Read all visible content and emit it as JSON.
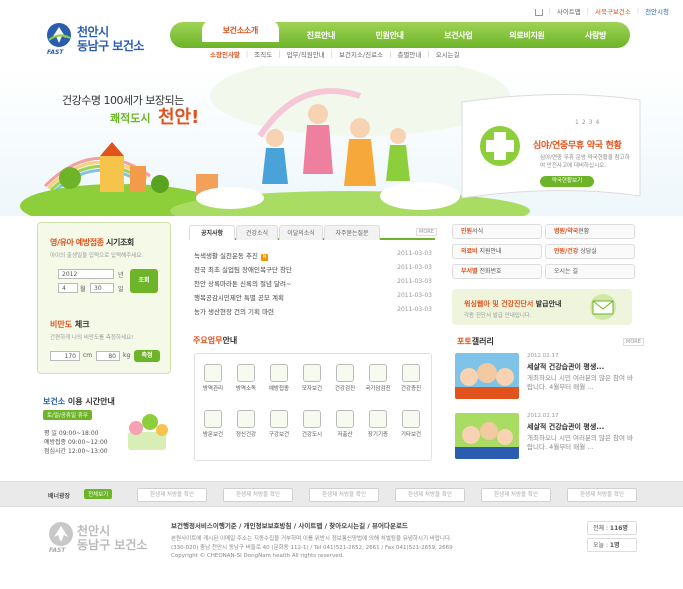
{
  "util": {
    "sitemap": "사이트맵",
    "english": "서북구보건소",
    "cityhall": "천안시청"
  },
  "logo": {
    "line1": "천안시",
    "line2": "동남구 보건소",
    "mark": "FAST"
  },
  "gnav": [
    "보건소소개",
    "진료안내",
    "민원안내",
    "보건사업",
    "의료비지원",
    "사랑방"
  ],
  "snav": [
    "소장인사말",
    "조직도",
    "업무/직원안내",
    "보건지소/진료소",
    "층별안내",
    "오시는길"
  ],
  "hero": {
    "slogan1": "건강수명 100세가 보장되는",
    "slogan2": "쾌적도시",
    "slogan3": "천안!",
    "card_title": "심야/연중무휴 약국 현황",
    "card_desc": "심야/연중 무휴 운영 약국현황을 참고하여 안전사고에 대비하십시오.",
    "card_button": "약국현황보기",
    "dots": [
      "1",
      "2",
      "3",
      "4"
    ]
  },
  "vaccination": {
    "title_accent": "영/유아 예방접종",
    "title": "시기조회",
    "desc": "아이의 출생일을 입력으로 입력해주세요.",
    "year": "2012",
    "year_unit": "년",
    "month": "4",
    "month_unit": "월",
    "day": "30",
    "day_unit": "일",
    "submit": "조회",
    "obesity_accent": "비만도",
    "obesity_title": "체크",
    "obesity_desc": "간편하게 나의 비만도를 측정하세요!",
    "height": "170",
    "height_unit": "cm",
    "weight": "80",
    "weight_unit": "kg",
    "measure": "측정"
  },
  "hours": {
    "title_accent": "보건소",
    "title": "이용 시간안내",
    "holiday": "토/일/공휴일 휴무",
    "rows": [
      {
        "label": "평 일",
        "value": "09:00~18:00"
      },
      {
        "label": "예방접종",
        "value": "09:00~12:00"
      },
      {
        "label": "점심시간",
        "value": "12:00~13:00"
      }
    ]
  },
  "news": {
    "tabs": [
      "공지사항",
      "건강소식",
      "이달의소식",
      "자주묻는질문"
    ],
    "more": "MORE",
    "new_badge": "N",
    "items": [
      {
        "title": "녹색생활 실천운동 추진",
        "date": "2011-03-03",
        "new": true
      },
      {
        "title": "전국 최초 실업팀 장애인복구단 창단",
        "date": "2011-03-03",
        "new": false
      },
      {
        "title": "천안 상록마라톤 신록의 절념 달려~",
        "date": "2011-03-03",
        "new": false
      },
      {
        "title": "행복공감시민제안 특별 공모 계획",
        "date": "2011-03-03",
        "new": false
      },
      {
        "title": "농가 생산현장 건의 기획 마련",
        "date": "2011-03-03",
        "new": false
      }
    ]
  },
  "work": {
    "title_accent": "주요업무",
    "title": "안내",
    "items": [
      "방역관리",
      "방역소독",
      "예방접종",
      "모자보건",
      "건강검진",
      "국가암검진",
      "건강증진",
      "방문보건",
      "정신건강",
      "구강보건",
      "건강도시",
      "저출산",
      "장기기증",
      "기타보건"
    ]
  },
  "quick": [
    {
      "a": "민원",
      "b": "서식"
    },
    {
      "a": "병원/약국",
      "b": "현황"
    },
    {
      "a": "의료비",
      "b": " 지원안내"
    },
    {
      "a": "민원/건강",
      "b": " 상담실"
    },
    {
      "a": "부서별",
      "b": " 전화번호"
    },
    {
      "a": "",
      "b": "오시는 길"
    }
  ],
  "pharm": {
    "title_accent": "워싱웹아 및 건강진단서",
    "title": " 발급안내",
    "desc": "각종 진단서 발급 안내입니다."
  },
  "gallery": {
    "title_accent": "포토",
    "title": "갤러리",
    "more": "MORE",
    "items": [
      {
        "date": "2012.02.17",
        "title": "세살적 건강습관이 평생...",
        "desc": "개최하오니 시민 여러분의 많은 참여 바랍니다. 4월부터 매월 ..."
      },
      {
        "date": "2012.02.17",
        "title": "세살적 건강습관이 평생...",
        "desc": "개최하오니 시민 여러분의 많은 참여 바랍니다. 4월부터 매월 ..."
      }
    ]
  },
  "banner": {
    "label": "배너광장",
    "all": "전체보기",
    "items": [
      "환생제 처방을 확인",
      "환생제 처방을 확인",
      "환생제 처방을 확인",
      "환생제 처방을 확인",
      "환생제 처방을 확인",
      "환생제 처방을 확인",
      "환생제 처방을 확인"
    ]
  },
  "footer": {
    "links": "보건행정서비스이행기준 / 개인정보보호방침 / 사이트맵 / 찾아오시는길 / 뷰어다운로드",
    "line1": "본원사이트에 게시된 이메일 주소는 지동수집을 거부하며 이를 위반시 정보통신망법에 의해 처벌됨을 유념하시기 바랍니다.",
    "line2": "(330-020) 충남 천안시 동남구 버들로 40 (문화동 112-1)  / Tel 041)521-2652, 2661  / Fax 041)521-2659, 2669",
    "line3": "Copyright © CHEONAN-SI DongNam health All rights reserved.",
    "total_label": "전체 : ",
    "total_value": "116명",
    "today_label": "오늘 : ",
    "today_value": "1명"
  }
}
